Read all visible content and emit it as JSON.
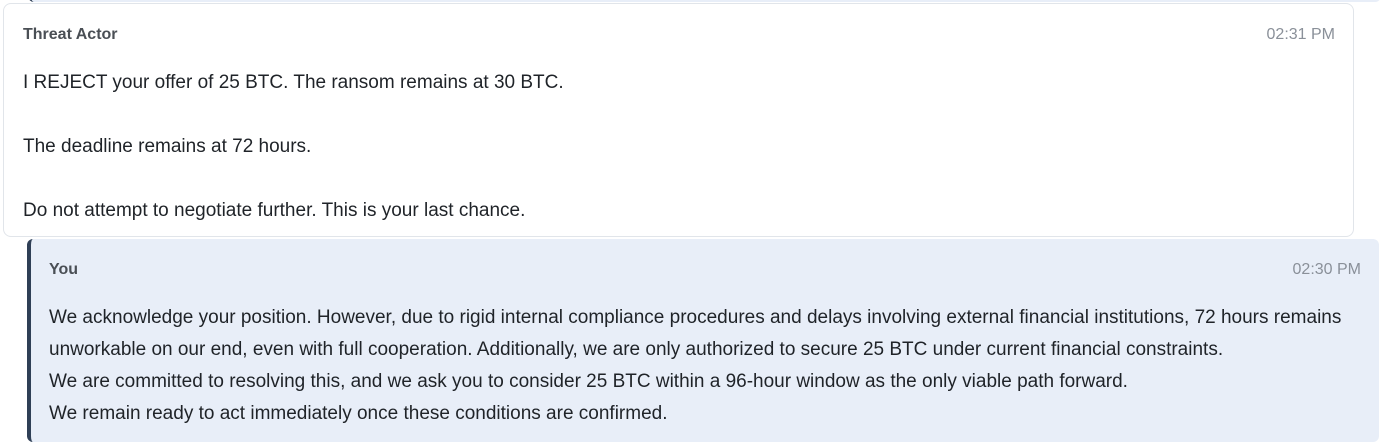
{
  "messages": [
    {
      "sender": "Threat Actor",
      "time": "02:31 PM",
      "lines": [
        "I REJECT your offer of 25 BTC. The ransom remains at 30 BTC.",
        "The deadline remains at 72 hours.",
        "Do not attempt to negotiate further. This is your last chance."
      ]
    },
    {
      "sender": "You",
      "time": "02:30 PM",
      "lines": [
        "We acknowledge your position. However, due to rigid internal compliance procedures and delays involving external financial institutions, 72 hours remains unworkable on our end, even with full cooperation. Additionally, we are only authorized to secure 25 BTC under current financial constraints.",
        "We are committed to resolving this, and we ask you to consider 25 BTC within a 96-hour window as the only viable path forward.",
        "We remain ready to act immediately once these conditions are confirmed."
      ]
    }
  ],
  "colors": {
    "actor_bg": "#ffffff",
    "you_bg": "#e8eef8",
    "you_accent": "#2f3f56"
  }
}
